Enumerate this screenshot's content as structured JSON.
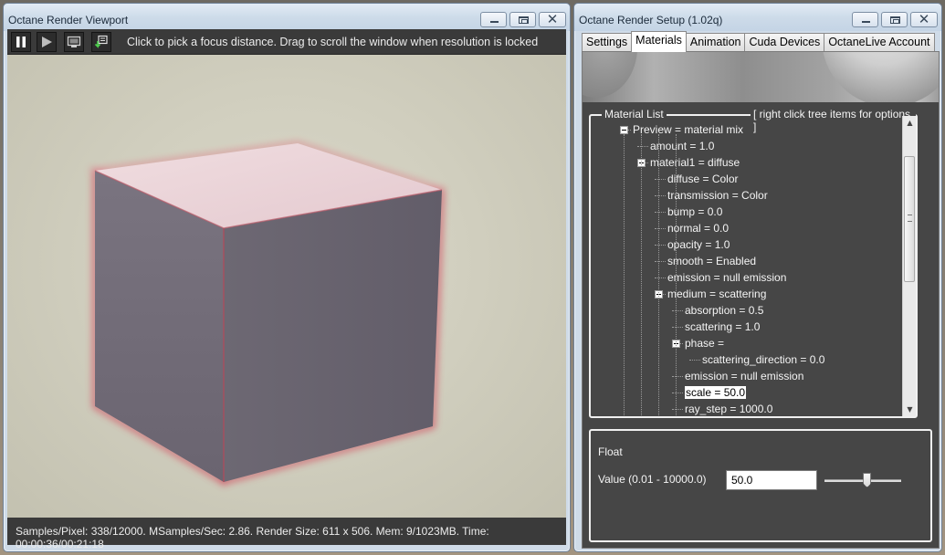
{
  "viewport": {
    "title": "Octane Render Viewport",
    "toolbar": {
      "hint": "Click to pick a focus distance.  Drag to scroll the window when resolution is locked",
      "buttons": [
        "pause-icon",
        "play-icon",
        "monitor-icon",
        "export-icon"
      ]
    },
    "status": "Samples/Pixel: 338/12000. MSamples/Sec: 2.86. Render Size: 611 x 506. Mem: 9/1023MB. Time: 00:00:36/00:21:18",
    "scene": {
      "cube_top": "#e9d3d8",
      "cube_front": "#6e6876",
      "cube_side": "#6a6570",
      "edge_glow": "#c9485a"
    }
  },
  "setup": {
    "title": "Octane Render Setup (1.02q)",
    "tabs": [
      "Settings",
      "Materials",
      "Animation",
      "Cuda Devices",
      "OctaneLive Account"
    ],
    "active_tab": "Materials",
    "material_list": {
      "label": "Material List",
      "hint": "[ right click tree items for options ]",
      "items": [
        {
          "text": "Preview = material mix",
          "level": 0,
          "expander": true
        },
        {
          "text": "amount = 1.0",
          "level": 1
        },
        {
          "text": "material1 = diffuse",
          "level": 1,
          "expander": true
        },
        {
          "text": "diffuse = Color",
          "level": 2
        },
        {
          "text": "transmission = Color",
          "level": 2
        },
        {
          "text": "bump = 0.0",
          "level": 2
        },
        {
          "text": "normal = 0.0",
          "level": 2
        },
        {
          "text": "opacity = 1.0",
          "level": 2
        },
        {
          "text": "smooth = Enabled",
          "level": 2
        },
        {
          "text": "emission = null emission",
          "level": 2
        },
        {
          "text": "medium = scattering",
          "level": 2,
          "expander": true
        },
        {
          "text": "absorption = 0.5",
          "level": 3
        },
        {
          "text": "scattering = 1.0",
          "level": 3
        },
        {
          "text": "phase =",
          "level": 3,
          "expander": true
        },
        {
          "text": "scattering_direction = 0.0",
          "level": 4
        },
        {
          "text": "emission = null emission",
          "level": 3
        },
        {
          "text": "scale = 50.0",
          "level": 3,
          "selected": true
        },
        {
          "text": "ray_step = 1000.0",
          "level": 3
        }
      ]
    },
    "float_panel": {
      "title": "Float",
      "value_label": "Value (0.01 - 10000.0)",
      "value": "50.0",
      "slider_fraction": 0.55
    }
  }
}
